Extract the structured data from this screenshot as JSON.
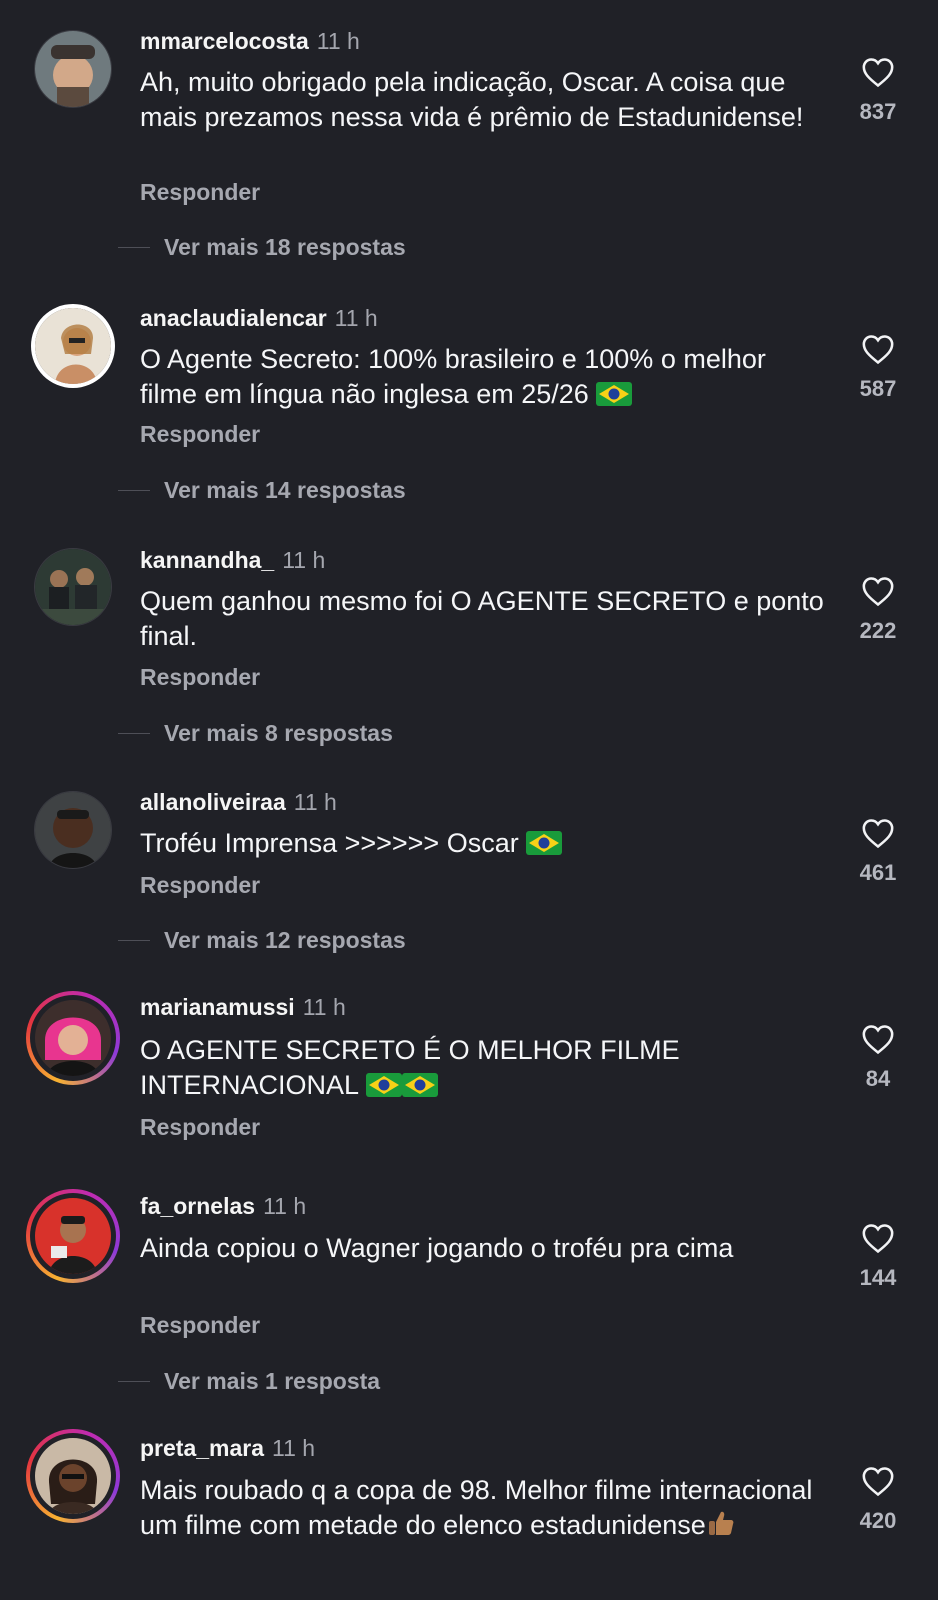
{
  "comments": [
    {
      "username": "mmarcelocosta",
      "time": "11 h",
      "text": "Ah, muito obrigado pela indicação, Oscar. A coisa que mais prezamos nessa vida é prêmio de Estadunidense!",
      "reply_label": "Responder",
      "likes": "837",
      "more_replies": "Ver mais 18 respostas"
    },
    {
      "username": "anaclaudialencar",
      "time": "11 h",
      "text": "O Agente Secreto: 100% brasileiro e 100% o melhor filme em língua não inglesa em 25/26",
      "reply_label": "Responder",
      "likes": "587",
      "more_replies": "Ver mais 14 respostas"
    },
    {
      "username": "kannandha_",
      "time": "11 h",
      "text": "Quem ganhou mesmo foi O AGENTE SECRETO e ponto final.",
      "reply_label": "Responder",
      "likes": "222",
      "more_replies": "Ver mais 8 respostas"
    },
    {
      "username": "allanoliveiraa",
      "time": "11 h",
      "text": "Troféu Imprensa >>>>>> Oscar",
      "reply_label": "Responder",
      "likes": "461",
      "more_replies": "Ver mais 12 respostas"
    },
    {
      "username": "marianamussi",
      "time": "11 h",
      "text": "O AGENTE SECRETO É O MELHOR FILME INTERNACIONAL",
      "reply_label": "Responder",
      "likes": "84"
    },
    {
      "username": "fa_ornelas",
      "time": "11 h",
      "text": "Ainda copiou o Wagner jogando o troféu pra cima",
      "reply_label": "Responder",
      "likes": "144",
      "more_replies": "Ver mais 1 resposta"
    },
    {
      "username": "preta_mara",
      "time": "11 h",
      "text": "Mais roubado q a copa de 98. Melhor filme internacional um filme com metade do elenco estadunidense",
      "likes": "420"
    }
  ],
  "icons": {
    "like": "heart-outline-icon",
    "flag": "brazil-flag-emoji",
    "thumbs": "thumbs-up-emoji"
  },
  "colors": {
    "background": "#202127",
    "text": "#f5f6f8",
    "muted": "#a6a8b0",
    "story_ring": [
      "#f7b232",
      "#e4343f",
      "#c02bb0"
    ]
  }
}
